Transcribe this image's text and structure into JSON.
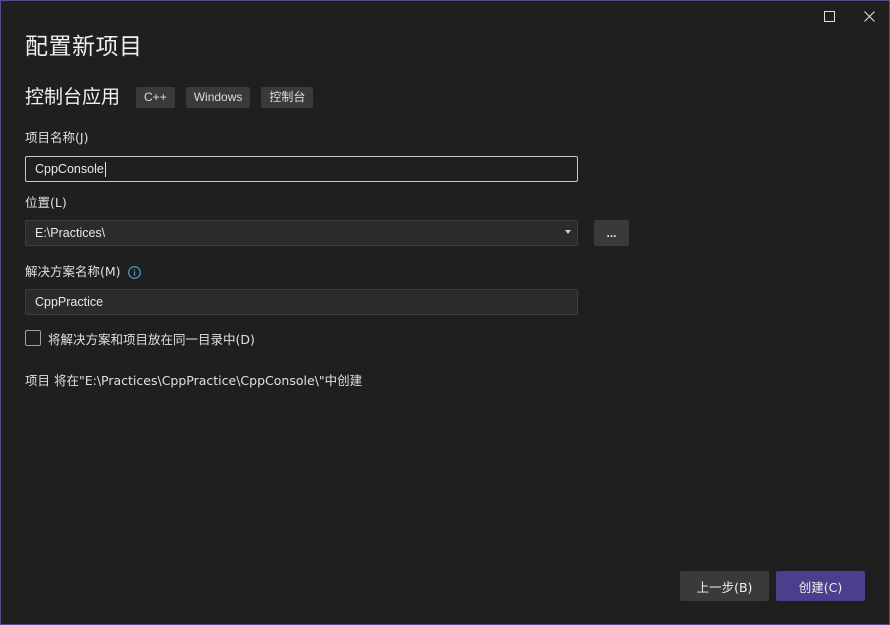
{
  "window": {
    "title": "配置新项目"
  },
  "template": {
    "name": "控制台应用",
    "tags": [
      "C++",
      "Windows",
      "控制台"
    ]
  },
  "fields": {
    "project_name": {
      "label": "项目名称(J)",
      "value": "CppConsole"
    },
    "location": {
      "label": "位置(L)",
      "value": "E:\\Practices\\",
      "browse_label": "..."
    },
    "solution_name": {
      "label": "解决方案名称(M)",
      "value": "CppPractice"
    }
  },
  "checkbox": {
    "label": "将解决方案和项目放在同一目录中(D)",
    "checked": false
  },
  "path_info": "项目 将在\"E:\\Practices\\CppPractice\\CppConsole\\\"中创建",
  "buttons": {
    "back": "上一步(B)",
    "create": "创建(C)"
  },
  "colors": {
    "background": "#1f1f1f",
    "accent": "#4b3e8c",
    "info_icon": "#4fa3e0"
  },
  "icons": {
    "maximize": "maximize-icon",
    "close": "close-icon",
    "info": "info-icon",
    "dropdown": "chevron-down-icon"
  }
}
